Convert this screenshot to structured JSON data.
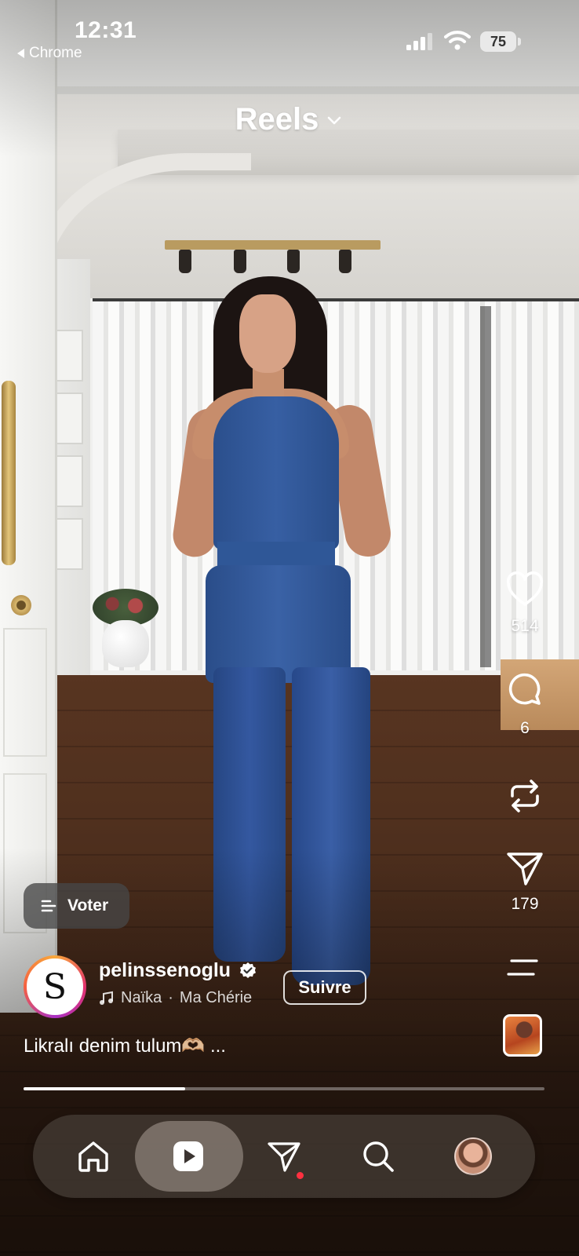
{
  "status_bar": {
    "time": "12:31",
    "back_app": "Chrome",
    "battery": "75"
  },
  "header": {
    "title": "Reels",
    "chevron_icon": "chevron-down-icon"
  },
  "actions": {
    "like": {
      "icon": "heart-icon",
      "count": "514"
    },
    "comment": {
      "icon": "comment-bubble-icon",
      "count": "6"
    },
    "repost": {
      "icon": "repost-icon"
    },
    "share": {
      "icon": "paper-plane-icon",
      "count": "179"
    },
    "more": {
      "icon": "menu-lines-icon"
    },
    "audio": {
      "icon": "audio-thumbnail"
    }
  },
  "poll": {
    "label": "Voter",
    "icon": "poll-icon"
  },
  "author": {
    "avatar_letter": "S",
    "username": "pelinssenoglu",
    "verified": true,
    "audio_artist": "Naïka",
    "audio_separator": " · ",
    "audio_track": "Ma Chérie",
    "follow_label": "Suivre"
  },
  "caption": {
    "text": "Likralı denim tulum🫶🏼 ..."
  },
  "playback": {
    "progress": 0.31
  },
  "nav": {
    "items": [
      {
        "name": "home",
        "icon": "home-icon"
      },
      {
        "name": "reels",
        "icon": "reels-play-icon",
        "active": true
      },
      {
        "name": "messages",
        "icon": "paper-plane-icon",
        "badge": true
      },
      {
        "name": "search",
        "icon": "search-icon"
      },
      {
        "name": "profile",
        "icon": "profile-avatar"
      }
    ]
  },
  "colors": {
    "accent_red": "#ff3040",
    "nav_bg": "#463e38",
    "follow_border": "#ffffff"
  }
}
